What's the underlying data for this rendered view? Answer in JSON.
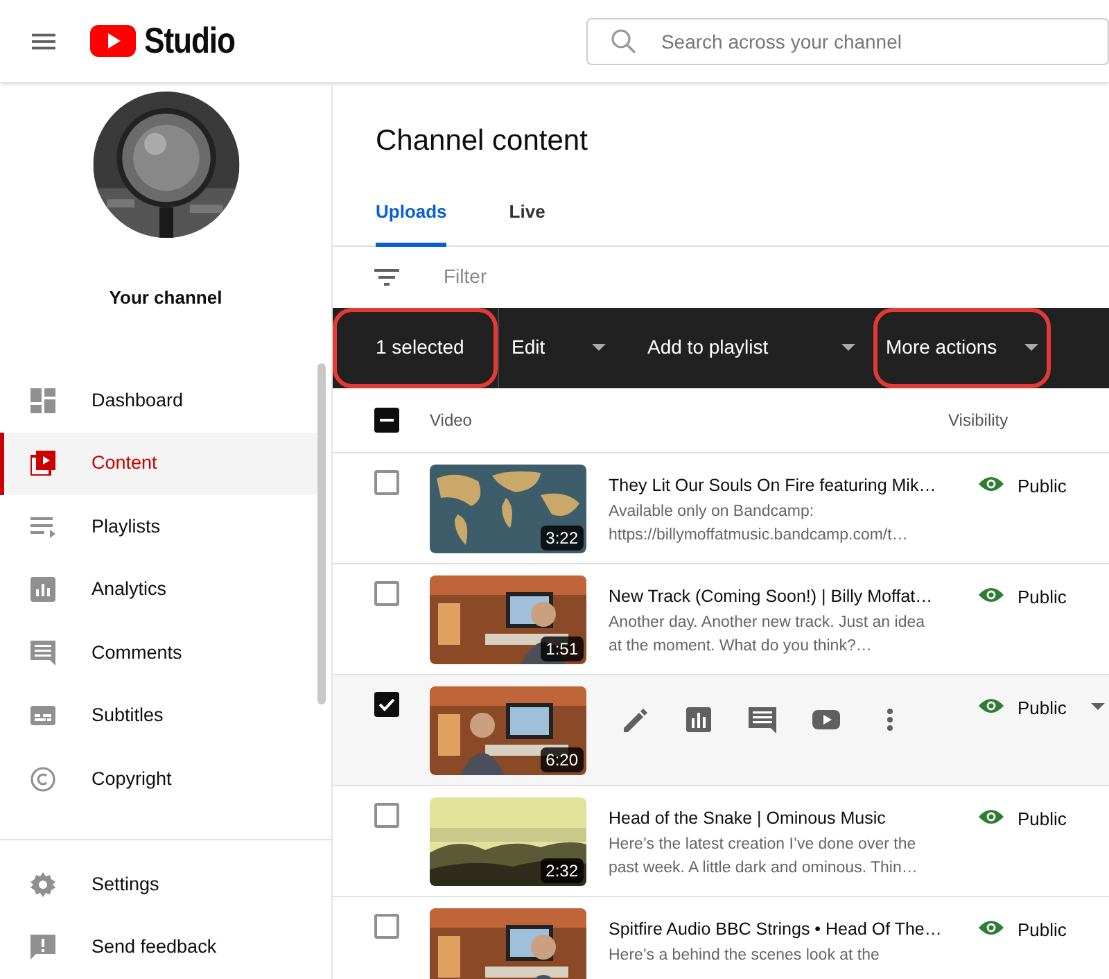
{
  "header": {
    "logo_text": "Studio",
    "search": {
      "placeholder": "Search across your channel"
    }
  },
  "sidebar": {
    "channel_label": "Your channel",
    "items": [
      {
        "label": "Dashboard",
        "selected": false
      },
      {
        "label": "Content",
        "selected": true
      },
      {
        "label": "Playlists",
        "selected": false
      },
      {
        "label": "Analytics",
        "selected": false
      },
      {
        "label": "Comments",
        "selected": false
      },
      {
        "label": "Subtitles",
        "selected": false
      },
      {
        "label": "Copyright",
        "selected": false
      }
    ],
    "footer_items": [
      {
        "label": "Settings"
      },
      {
        "label": "Send feedback"
      }
    ]
  },
  "page_title": "Channel content",
  "tabs": [
    {
      "label": "Uploads",
      "selected": true
    },
    {
      "label": "Live",
      "selected": false
    }
  ],
  "filter": {
    "placeholder": "Filter"
  },
  "bulk_bar": {
    "count": {
      "label": "1 selected",
      "highlighted": true
    },
    "actions": [
      {
        "label": "Edit",
        "highlighted": false
      },
      {
        "label": "Add to playlist",
        "highlighted": false
      },
      {
        "label": "More actions",
        "highlighted": true
      }
    ]
  },
  "table": {
    "select_all": {
      "indeterminate": true
    },
    "columns": [
      "Video",
      "Visibility"
    ],
    "rows": [
      {
        "kind": "text",
        "checked": false,
        "title": "They Lit Our Souls On Fire featuring Mik…",
        "description": "Available only on Bandcamp: https://billymoffatmusic.bandcamp.com/t…",
        "duration": "3:22",
        "visibility": "Public",
        "dropdown": false
      },
      {
        "kind": "text",
        "checked": false,
        "title": "New Track (Coming Soon!) | Billy Moffat…",
        "description": "Another day. Another new track. Just an idea at the moment. What do you think?…",
        "duration": "1:51",
        "visibility": "Public",
        "dropdown": false
      },
      {
        "kind": "actions",
        "checked": true,
        "duration": "6:20",
        "visibility": "Public",
        "dropdown": true
      },
      {
        "kind": "text",
        "checked": false,
        "title": "Head of the Snake | Ominous Music",
        "description": "Here’s the latest creation I’ve done over the past week. A little dark and ominous. Thin…",
        "duration": "2:32",
        "visibility": "Public",
        "dropdown": false
      },
      {
        "kind": "text",
        "checked": false,
        "title": "Spitfire Audio BBC Strings • Head Of The…",
        "description": "Here’s a behind the scenes look at the",
        "visibility": "Public",
        "dropdown": false
      }
    ]
  }
}
